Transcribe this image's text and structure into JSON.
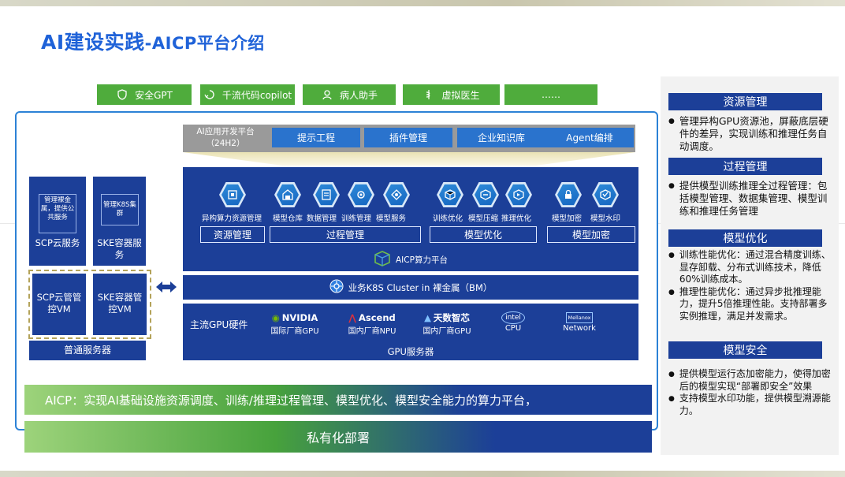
{
  "title": {
    "main": "AI建设实践",
    "sub": "-AICP平台介绍"
  },
  "apps": [
    {
      "label": "安全GPT",
      "icon": "shield-icon"
    },
    {
      "label": "千流代码copilot",
      "icon": "cycle-icon"
    },
    {
      "label": "病人助手",
      "icon": "person-icon"
    },
    {
      "label": "虚拟医生",
      "icon": "medical-icon"
    },
    {
      "label": "……",
      "icon": ""
    }
  ],
  "dev_platform": {
    "label": "AI应用开发平台（24H2）",
    "buttons": [
      "提示工程",
      "插件管理",
      "企业知识库",
      "Agent编排"
    ]
  },
  "aicp": {
    "icons": [
      "异构算力资源管理",
      "模型仓库",
      "数据管理",
      "训练管理",
      "模型服务",
      "训练优化",
      "模型压缩",
      "推理优化",
      "模型加密",
      "模型水印"
    ],
    "categories": [
      "资源管理",
      "过程管理",
      "模型优化",
      "模型加密"
    ],
    "platform_label": "AICP算力平台"
  },
  "k8s": "业务K8S Cluster in 裸金属（BM）",
  "gpu": {
    "label": "主流GPU硬件",
    "vendors": [
      {
        "logo": "NVIDIA",
        "caption": "国际厂商GPU"
      },
      {
        "logo": "Ascend",
        "caption": "国内厂商NPU"
      },
      {
        "logo": "天数智芯",
        "caption": "国内厂商GPU"
      },
      {
        "logo": "intel",
        "caption": "CPU"
      },
      {
        "logo": "Mellanox",
        "caption": "Network"
      }
    ],
    "footer": "GPU服务器"
  },
  "servers": {
    "scp_inner": "管理裸金属，提供公共服务",
    "scp": "SCP云服务",
    "ske_inner": "管理K8S集群",
    "ske": "SKE容器服务",
    "scp_vm": "SCP云管管控VM",
    "ske_vm": "SKE容器管控VM",
    "normal": "普通服务器"
  },
  "banner": "AICP：实现AI基础设施资源调度、训练/推理过程管理、模型优化、模型安全能力的算力平台，",
  "deploy": "私有化部署",
  "right": [
    {
      "head": "资源管理",
      "items": [
        "管理异构GPU资源池，屏蔽底层硬件的差异，实现训练和推理任务自动调度。"
      ]
    },
    {
      "head": "过程管理",
      "items": [
        "提供模型训练推理全过程管理：包括模型管理、数据集管理、模型训练和推理任务管理"
      ]
    },
    {
      "head": "模型优化",
      "items": [
        "训练性能优化：通过混合精度训练、显存卸载、分布式训练技术，降低60%训练成本。",
        "推理性能优化：通过异步批推理能力，提升5倍推理性能。支持部署多实例推理，满足并发需求。"
      ]
    },
    {
      "head": "模型安全",
      "items": [
        "提供模型运行态加密能力，使得加密后的模型实现“部署即安全”效果",
        "支持模型水印功能，提供模型溯源能力。"
      ]
    }
  ]
}
